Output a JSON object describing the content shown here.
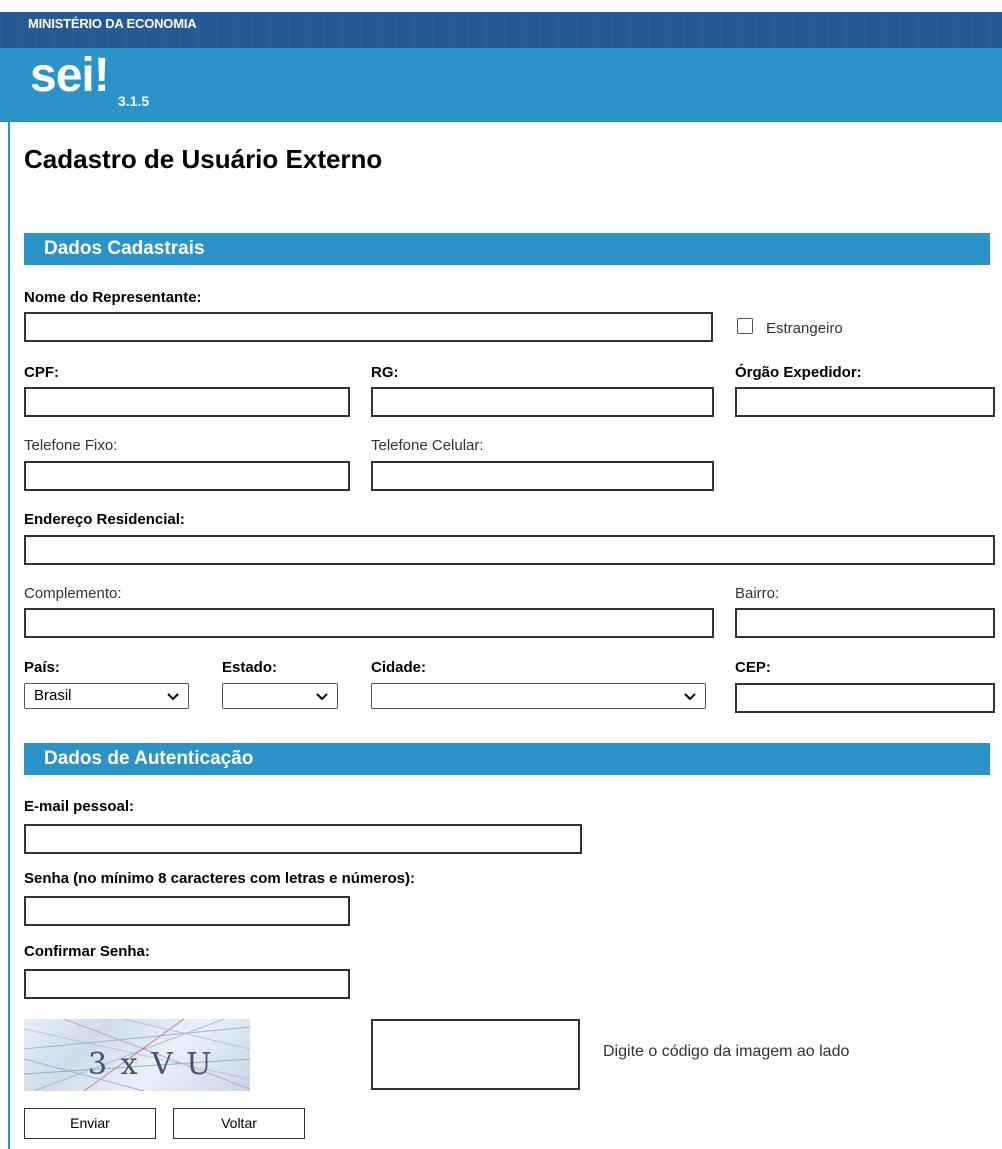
{
  "header": {
    "ministry": "MINISTÉRIO DA ECONOMIA",
    "logo": "sei!",
    "version": "3.1.5"
  },
  "page": {
    "title": "Cadastro de Usuário Externo"
  },
  "sections": {
    "dados_cadastrais": "Dados Cadastrais",
    "dados_autenticacao": "Dados de Autenticação"
  },
  "form": {
    "nome_label": "Nome do Representante:",
    "estrangeiro_label": "Estrangeiro",
    "cpf_label": "CPF:",
    "rg_label": "RG:",
    "orgao_label": "Órgão Expedidor:",
    "tel_fixo_label": "Telefone Fixo:",
    "tel_celular_label": "Telefone Celular:",
    "endereco_label": "Endereço Residencial:",
    "complemento_label": "Complemento:",
    "bairro_label": "Bairro:",
    "pais_label": "País:",
    "pais_value": "Brasil",
    "estado_label": "Estado:",
    "estado_value": "",
    "cidade_label": "Cidade:",
    "cidade_value": "",
    "cep_label": "CEP:",
    "email_label": "E-mail pessoal:",
    "senha_label": "Senha (no mínimo 8 caracteres com letras e números):",
    "confirmar_label": "Confirmar Senha:",
    "captcha_text": "3 x V U",
    "captcha_hint": "Digite o código da imagem ao lado"
  },
  "buttons": {
    "enviar": "Enviar",
    "voltar": "Voltar"
  },
  "colors": {
    "ministry_bar": "#255a92",
    "sei_bar": "#2b93c8",
    "section_bar": "#2b93c8"
  },
  "icons": {
    "select_arrow": "chevron-down-icon",
    "checkbox": "checkbox-icon"
  }
}
